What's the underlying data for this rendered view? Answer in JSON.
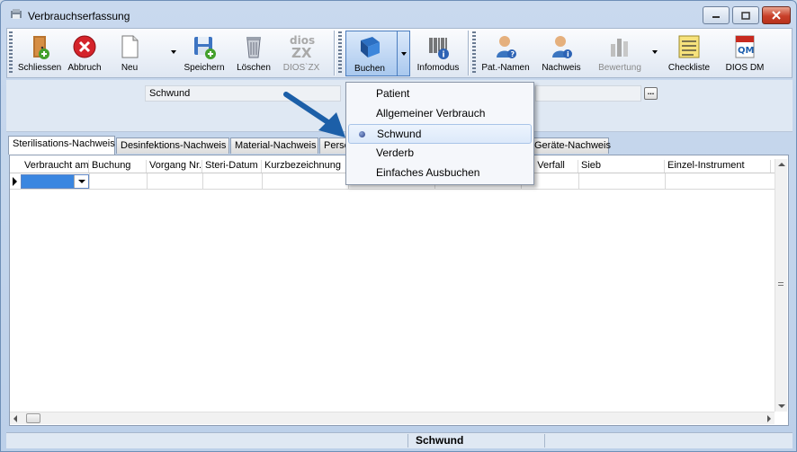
{
  "window": {
    "title": "Verbrauchserfassung"
  },
  "toolbar": {
    "buttons": [
      {
        "label": "Schliessen",
        "icon": "door-exit-icon"
      },
      {
        "label": "Abbruch",
        "icon": "cancel-icon"
      },
      {
        "label": "Neu",
        "icon": "new-document-icon"
      },
      {
        "label": "Speichern",
        "icon": "save-icon"
      },
      {
        "label": "Löschen",
        "icon": "trash-icon"
      },
      {
        "label": "DIOS`ZX",
        "icon": "dios-zx-logo"
      },
      {
        "label": "Buchen",
        "icon": "book-icon"
      },
      {
        "label": "Infomodus",
        "icon": "barcode-info-icon"
      },
      {
        "label": "Pat.-Namen",
        "icon": "patient-icon"
      },
      {
        "label": "Nachweis",
        "icon": "user-info-icon"
      },
      {
        "label": "Bewertung",
        "icon": "rating-chart-icon"
      },
      {
        "label": "Checkliste",
        "icon": "checklist-icon"
      },
      {
        "label": "DIOS DM",
        "icon": "pdf-qm-icon"
      }
    ]
  },
  "fields": {
    "booking_type": "Schwund"
  },
  "tabs": [
    "Sterilisations-Nachweis",
    "Desinfektions-Nachweis",
    "Material-Nachweis",
    "Perso",
    "Geräte-Nachweis"
  ],
  "grid": {
    "columns": [
      "Verbraucht am",
      "Buchung",
      "Vorgang Nr.",
      "Steri-Datum",
      "Kurzbezeichnung",
      "nt. Verfall",
      "Sieb",
      "Einzel-Instrument"
    ]
  },
  "menu": {
    "items": [
      "Patient",
      "Allgemeiner Verbrauch",
      "Schwund",
      "Verderb",
      "Einfaches Ausbuchen"
    ],
    "selected": "Schwund"
  },
  "status": {
    "text": "Schwund"
  },
  "colors": {
    "accent": "#1c5fa8",
    "arrow": "#1c5fa8",
    "selection": "#3a86e0"
  }
}
